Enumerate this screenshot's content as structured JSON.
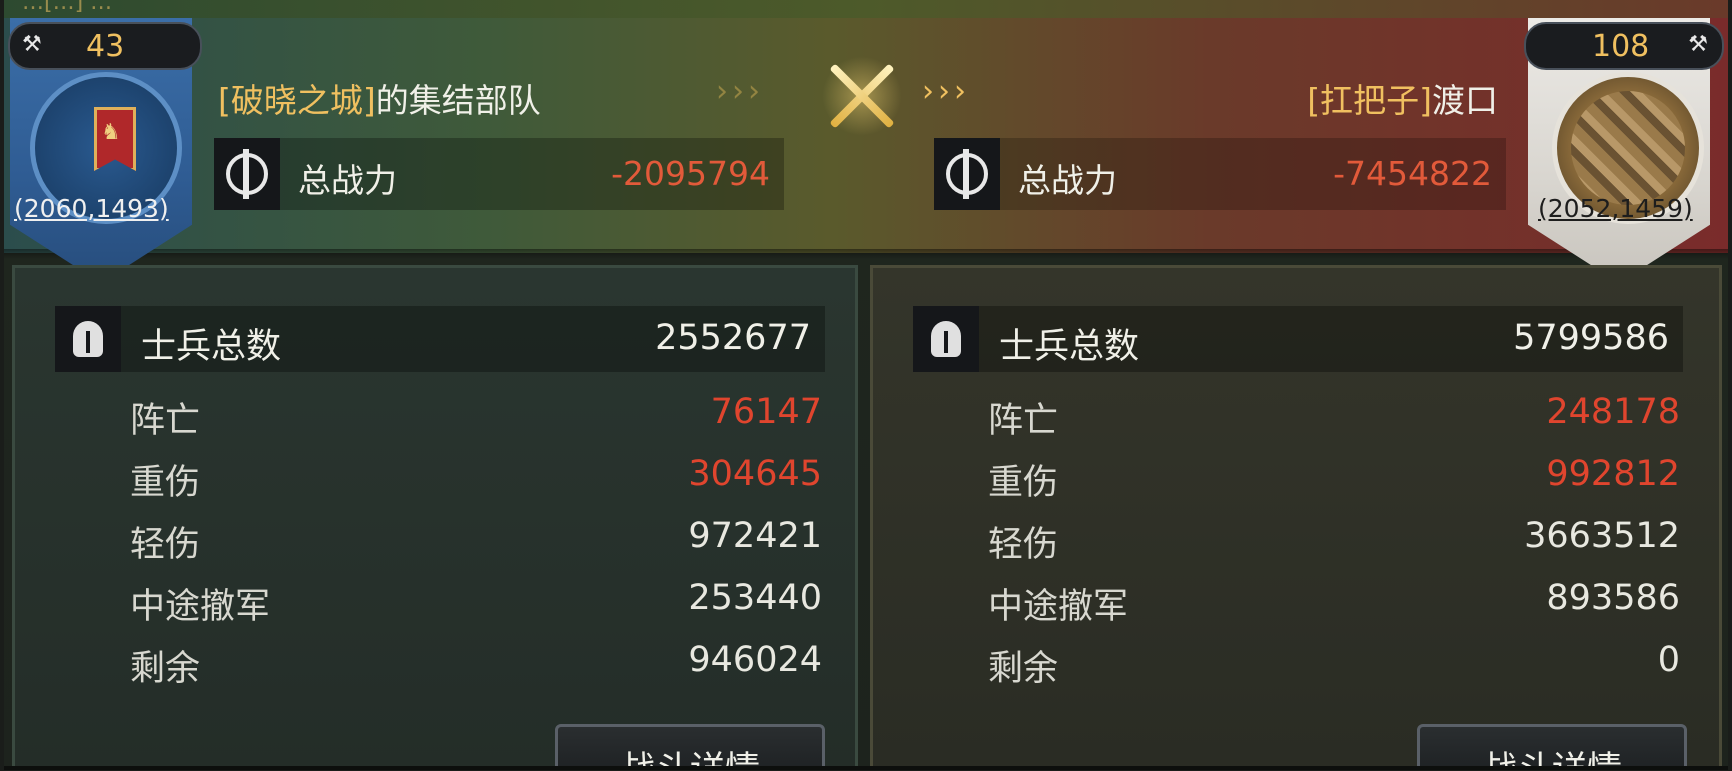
{
  "top_text": "…[…] …",
  "attacker": {
    "level": "43",
    "name_tag": "[破晓之城]",
    "name_rest": "的集结部队",
    "coords": "(2060,1493)",
    "power_label": "总战力",
    "power_value": "-2095794",
    "total_label": "士兵总数",
    "total_value": "2552677",
    "stats": [
      {
        "label": "阵亡",
        "value": "76147"
      },
      {
        "label": "重伤",
        "value": "304645"
      },
      {
        "label": "轻伤",
        "value": "972421"
      },
      {
        "label": "中途撤军",
        "value": "253440"
      },
      {
        "label": "剩余",
        "value": "946024"
      }
    ],
    "detail_button": "战斗详情"
  },
  "defender": {
    "level": "108",
    "name_tag": "[扛把子]",
    "name_rest": "渡口",
    "coords": "(2052,1459)",
    "power_label": "总战力",
    "power_value": "-7454822",
    "total_label": "士兵总数",
    "total_value": "5799586",
    "stats": [
      {
        "label": "阵亡",
        "value": "248178"
      },
      {
        "label": "重伤",
        "value": "992812"
      },
      {
        "label": "轻伤",
        "value": "3663512"
      },
      {
        "label": "中途撤军",
        "value": "893586"
      },
      {
        "label": "剩余",
        "value": "0"
      }
    ],
    "detail_button": "战斗详情"
  },
  "icons": {
    "versus": "crossed-swords-icon",
    "power": "power-icon",
    "troops": "helmet-icon",
    "alliance": "axe-icon"
  },
  "colors": {
    "loss_red": "#e0452e",
    "power_red": "#e25a3a",
    "tag_gold": "#f0c060"
  }
}
